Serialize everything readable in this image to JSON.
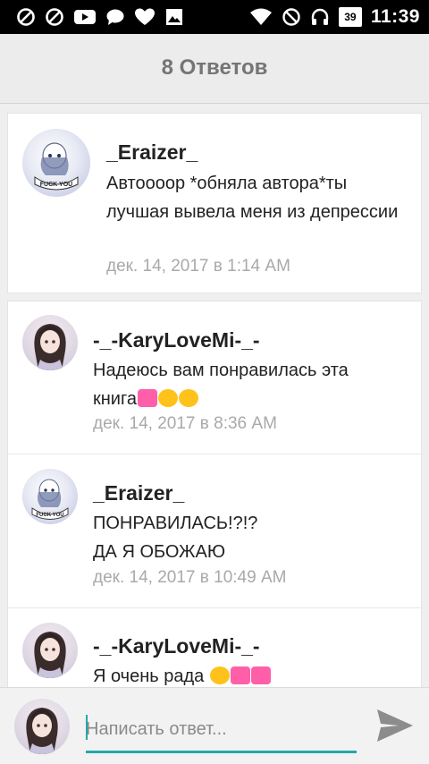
{
  "status_bar": {
    "left_icons": [
      "blocked-icon",
      "blocked-icon",
      "youtube-icon",
      "chat-bubble-icon",
      "heart-icon",
      "gallery-icon"
    ],
    "right_icons": [
      "wifi-icon",
      "do-not-disturb-icon",
      "headphones-icon"
    ],
    "battery": "39",
    "time": "11:39"
  },
  "header": {
    "title": "8 Ответов"
  },
  "comments": [
    {
      "author": "_Eraizer_",
      "text": "Автоооор *обняла автора*ты лучшая вывела меня из депрессии",
      "time": "дек. 14, 2017 в 1:14 AM",
      "avatar_label": "FUCK YOU"
    },
    {
      "author": "-_-KaryLoveMi-_-",
      "text": "Надеюсь вам понравилась эта книга",
      "emojis": [
        "sparkling-heart-emoji",
        "heart-eyes-emoji",
        "kissing-emoji"
      ],
      "time": "дек. 14, 2017 в 8:36 AM"
    },
    {
      "author": "_Eraizer_",
      "text_line1": "ПОНРАВИЛАСЬ!?!?",
      "text_line2": "ДА Я ОБОЖАЮ",
      "time": "дек. 14, 2017 в 10:49 AM",
      "avatar_label": "FUCK YOU"
    },
    {
      "author": "-_-KaryLoveMi-_-",
      "text": "Я очень рада",
      "emojis": [
        "kissing-heart-emoji",
        "sparkling-heart-emoji",
        "sparkling-heart-emoji"
      ]
    }
  ],
  "composer": {
    "placeholder": "Написать ответ...",
    "send_icon": "send-icon"
  },
  "colors": {
    "accent": "#26a7a8",
    "timestamp": "#a9a9a9",
    "header_title": "#757575"
  }
}
